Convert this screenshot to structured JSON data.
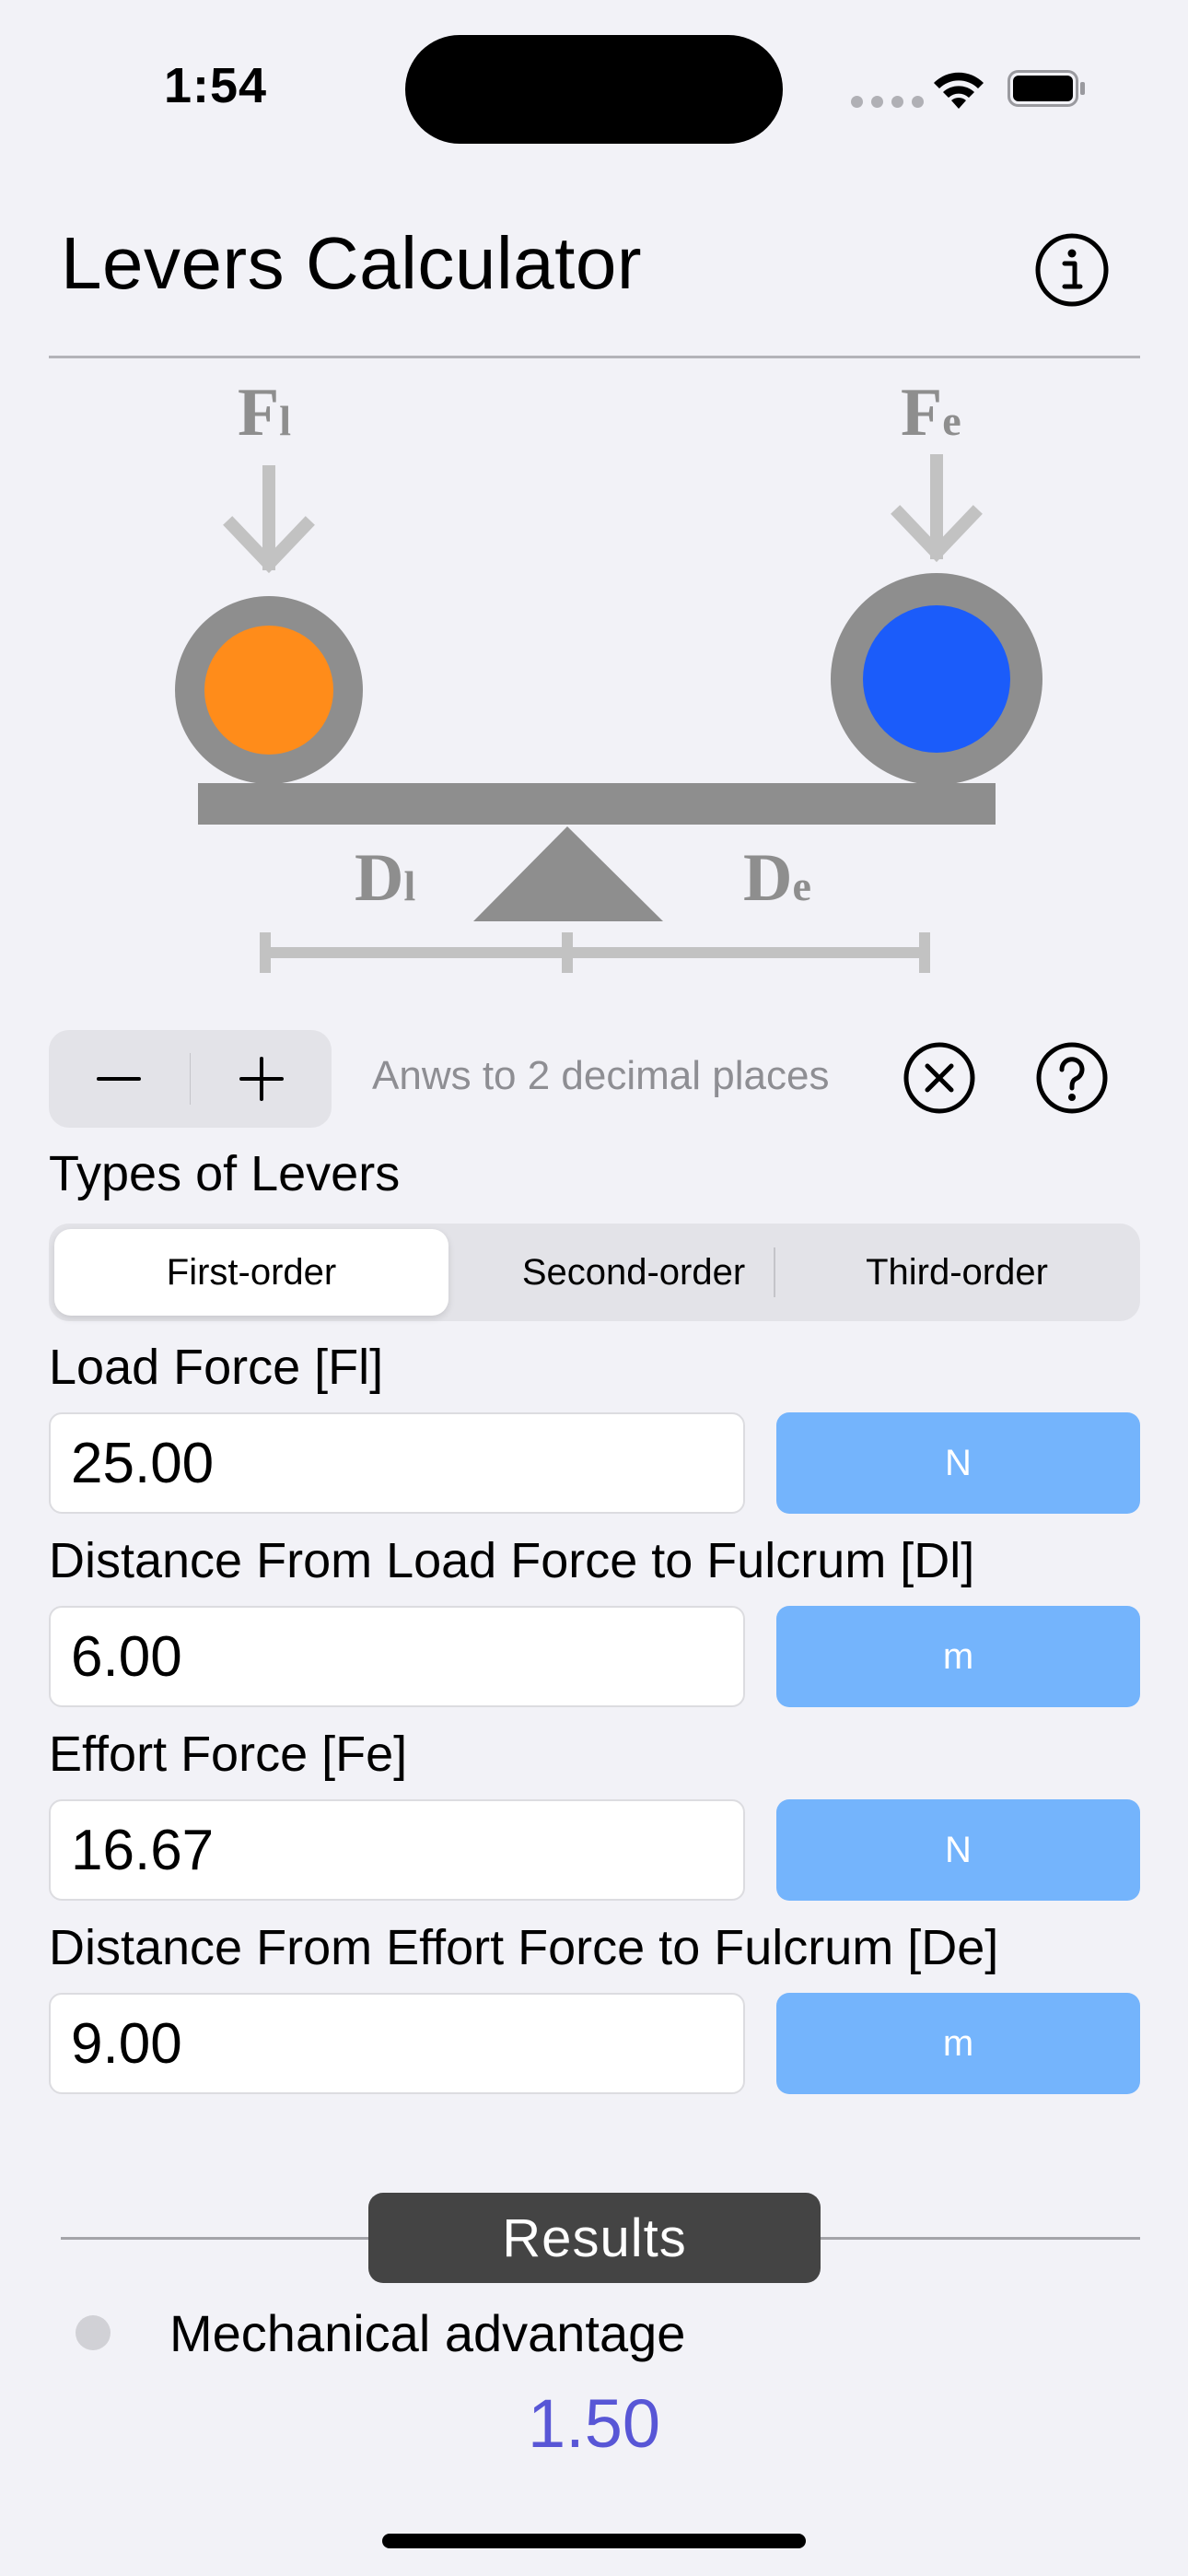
{
  "status_bar": {
    "time": "1:54"
  },
  "header": {
    "title": "Levers Calculator"
  },
  "diagram": {
    "load_force_symbol": {
      "base": "F",
      "sub": "l"
    },
    "effort_force_symbol": {
      "base": "F",
      "sub": "e"
    },
    "load_distance_symbol": {
      "base": "D",
      "sub": "l"
    },
    "effort_distance_symbol": {
      "base": "D",
      "sub": "e"
    },
    "colors": {
      "load": "#ff8c1a",
      "effort": "#1b5cfa",
      "structure": "#8e8e8e",
      "arrows": "#c2c2c2"
    }
  },
  "controls": {
    "decimal_hint": "Anws to 2 decimal places"
  },
  "types": {
    "label": "Types of Levers",
    "options": [
      "First-order",
      "Second-order",
      "Third-order"
    ],
    "selected": "First-order"
  },
  "fields": [
    {
      "label": "Load Force [Fl]",
      "value": "25.00",
      "unit": "N"
    },
    {
      "label": "Distance From Load Force to Fulcrum [Dl]",
      "value": "6.00",
      "unit": "m"
    },
    {
      "label": "Effort Force [Fe]",
      "value": "16.67",
      "unit": "N"
    },
    {
      "label": "Distance From Effort Force to Fulcrum [De]",
      "value": "9.00",
      "unit": "m"
    }
  ],
  "results": {
    "heading": "Results",
    "items": [
      {
        "label": "Mechanical advantage",
        "value": "1.50"
      }
    ]
  },
  "accent_color": "#5856d6",
  "unit_button_color": "#74b4fc"
}
